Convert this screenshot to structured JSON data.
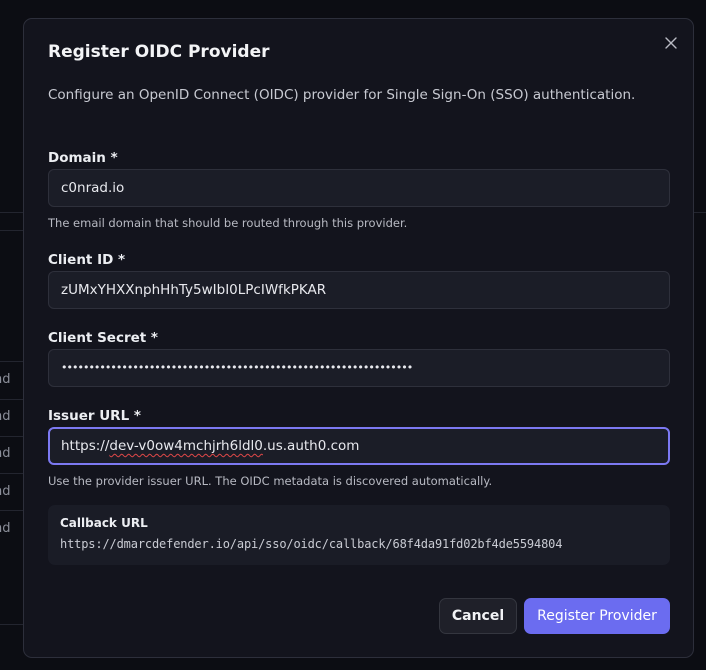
{
  "background": {
    "row_fragment": "end"
  },
  "dialog": {
    "title": "Register OIDC Provider",
    "description": "Configure an OpenID Connect (OIDC) provider for Single Sign-On (SSO) authentication.",
    "close_icon": "close-icon"
  },
  "form": {
    "domain": {
      "label": "Domain *",
      "value": "c0nrad.io",
      "help": "The email domain that should be routed through this provider."
    },
    "client_id": {
      "label": "Client ID *",
      "value": "zUMxYHXXnphHhTy5wIbI0LPcIWfkPKAR"
    },
    "client_secret": {
      "label": "Client Secret *",
      "value": "••••••••••••••••••••••••••••••••••••••••••••••••••••••••••••••••"
    },
    "issuer_url": {
      "label": "Issuer URL *",
      "value_prefix": "https://",
      "value_squiggle": "dev-v0ow4mchjrh6ldl0",
      "value_suffix": ".us.auth0.com",
      "help": "Use the provider issuer URL. The OIDC metadata is discovered automatically."
    }
  },
  "callback": {
    "title": "Callback URL",
    "url": "https://dmarcdefender.io/api/sso/oidc/callback/68f4da91fd02bf4de5594804"
  },
  "actions": {
    "cancel_label": "Cancel",
    "register_label": "Register Provider"
  }
}
